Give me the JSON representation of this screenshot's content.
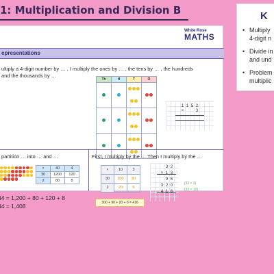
{
  "slide": {
    "unit_title": "1: Multiplication and Division B"
  },
  "brand": {
    "top": "White Rose",
    "main": "MATHS"
  },
  "section": {
    "heading": "epresentations"
  },
  "prompt1": {
    "line1": "ultiply a 4-digit number by … , I multiply the ones by … , the tens by … , the hundreds",
    "line2": "and the thousands by …"
  },
  "place_value_table": {
    "headers": [
      "Th",
      "H",
      "T",
      "O"
    ],
    "rows": [
      {
        "th": 1,
        "h": 1,
        "t": 5,
        "o": 2
      },
      {
        "th": 1,
        "h": 1,
        "t": 5,
        "o": 2
      },
      {
        "th": 1,
        "h": 1,
        "t": 5,
        "o": 2
      }
    ]
  },
  "column_calc": {
    "top": [
      "1",
      "1",
      "5",
      "2"
    ],
    "times": "×",
    "multiplier": "3"
  },
  "prompt2": "partition … into … and …",
  "partition_table": {
    "rows": [
      [
        "×",
        "40",
        "4"
      ],
      [
        "30",
        "1200",
        "120"
      ],
      [
        "2",
        "80",
        "8"
      ]
    ]
  },
  "equations": {
    "eq1": "44 = 1,200 + 80 + 120 + 8",
    "eq2": "44 = 1,408"
  },
  "prompt3": "First, I multiply by the … Then I multiply by the …",
  "area_table": {
    "rows": [
      [
        "×",
        "10",
        "3"
      ],
      [
        "30",
        "300",
        "90"
      ],
      [
        "2",
        "20",
        "6"
      ]
    ]
  },
  "sum_box": "300 + 90 + 20 + 6 = 416",
  "column_calc2": {
    "rows": [
      [
        "",
        "3",
        "2"
      ],
      [
        "×",
        "1",
        "3"
      ],
      [
        "",
        "9",
        "6"
      ],
      [
        "3",
        "2",
        "0"
      ],
      [
        "4",
        "1",
        "6"
      ]
    ],
    "note1": "(32 × 3)",
    "note2": "(32 × 10)"
  },
  "side_panel": {
    "title": "K",
    "items": [
      {
        "line1": "Multiply",
        "line2": "4-digit n"
      },
      {
        "line1": "Divide in",
        "line2": "and und"
      },
      {
        "line1": "Problem",
        "line2": "multiplic"
      }
    ]
  },
  "colors": {
    "background": "#f49ac9",
    "title": "#3a2a5c",
    "brand": "#2d2e74",
    "section_bar": "#c9c2e8",
    "counter_thousand": "#2e9e6a",
    "counter_hundred": "#2bb0c9",
    "counter_ten": "#f5c31b",
    "counter_one": "#e0433a"
  }
}
